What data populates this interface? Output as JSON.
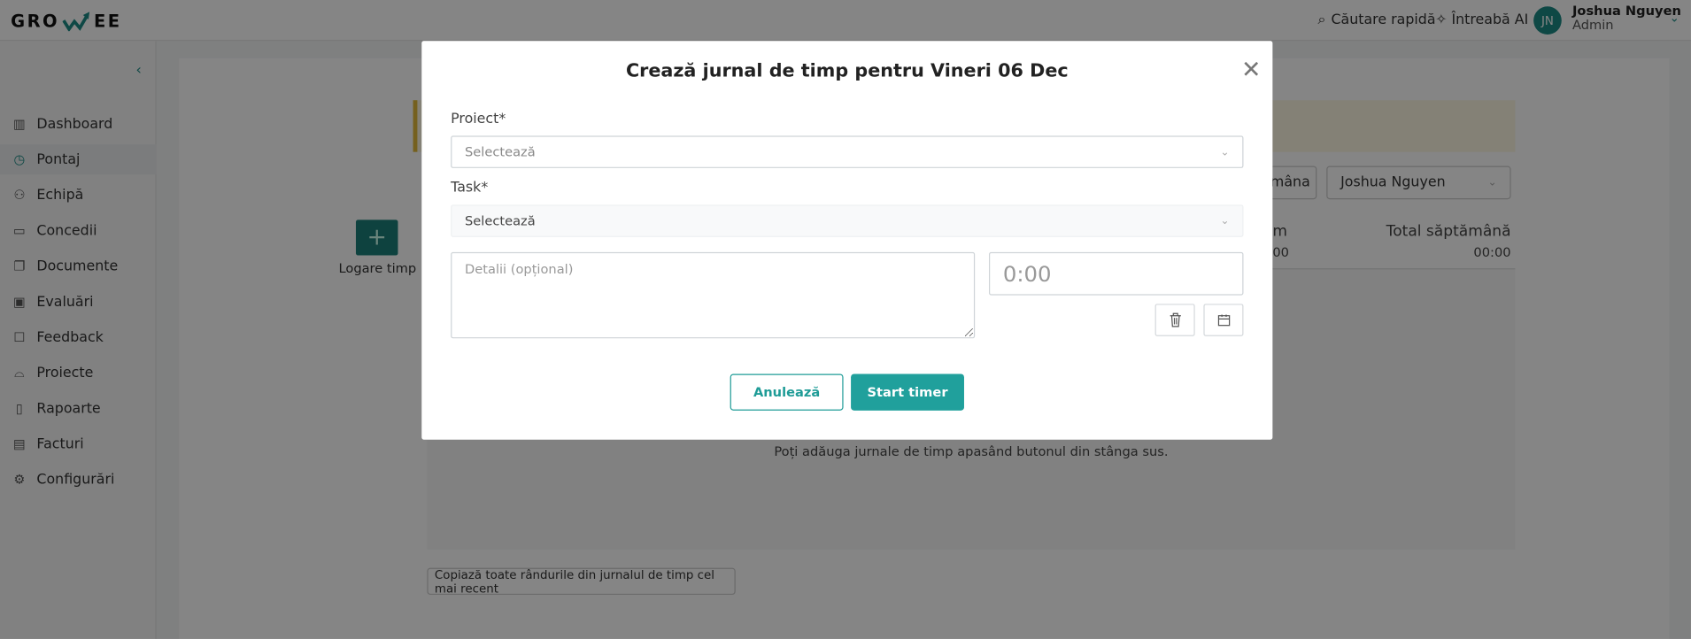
{
  "header": {
    "logo": "GROWEE",
    "search_label": "Căutare rapidă",
    "ai_label": "Întreabă AI",
    "user": {
      "initials": "JN",
      "name": "Joshua Nguyen",
      "role": "Admin"
    }
  },
  "sidebar": {
    "items": [
      {
        "label": "Dashboard",
        "icon": "bar-chart-icon"
      },
      {
        "label": "Pontaj",
        "icon": "clock-icon",
        "active": true
      },
      {
        "label": "Echipă",
        "icon": "users-icon"
      },
      {
        "label": "Concedii",
        "icon": "calendar-icon"
      },
      {
        "label": "Documente",
        "icon": "documents-icon"
      },
      {
        "label": "Evaluări",
        "icon": "presentation-icon"
      },
      {
        "label": "Feedback",
        "icon": "chat-icon"
      },
      {
        "label": "Proiecte",
        "icon": "inbox-icon"
      },
      {
        "label": "Rapoarte",
        "icon": "report-icon"
      },
      {
        "label": "Facturi",
        "icon": "invoice-icon"
      },
      {
        "label": "Configurări",
        "icon": "gear-icon"
      }
    ]
  },
  "main": {
    "log_time_label": "Logare timp",
    "week_button_partial": "mâna",
    "user_select": "Joshua Nguyen",
    "col_partial": "m",
    "col_partial_value": "00",
    "total_week_label": "Total săptămână",
    "total_week_value": "00:00",
    "empty_text": "Poți adăuga jurnale de timp apasând butonul din stânga sus.",
    "copy_button": "Copiază toate rândurile din jurnalul de timp cel mai recent"
  },
  "modal": {
    "title": "Crează jurnal de timp pentru Vineri 06 Dec",
    "project_label": "Proiect*",
    "project_placeholder": "Selectează",
    "task_label": "Task*",
    "task_placeholder": "Selectează",
    "details_placeholder": "Detalii (opțional)",
    "time_placeholder": "0:00",
    "cancel_label": "Anulează",
    "start_label": "Start timer"
  },
  "colors": {
    "accent": "#20a09c",
    "dark_accent": "#1b7f7a",
    "notice": "#fdf8e3"
  }
}
